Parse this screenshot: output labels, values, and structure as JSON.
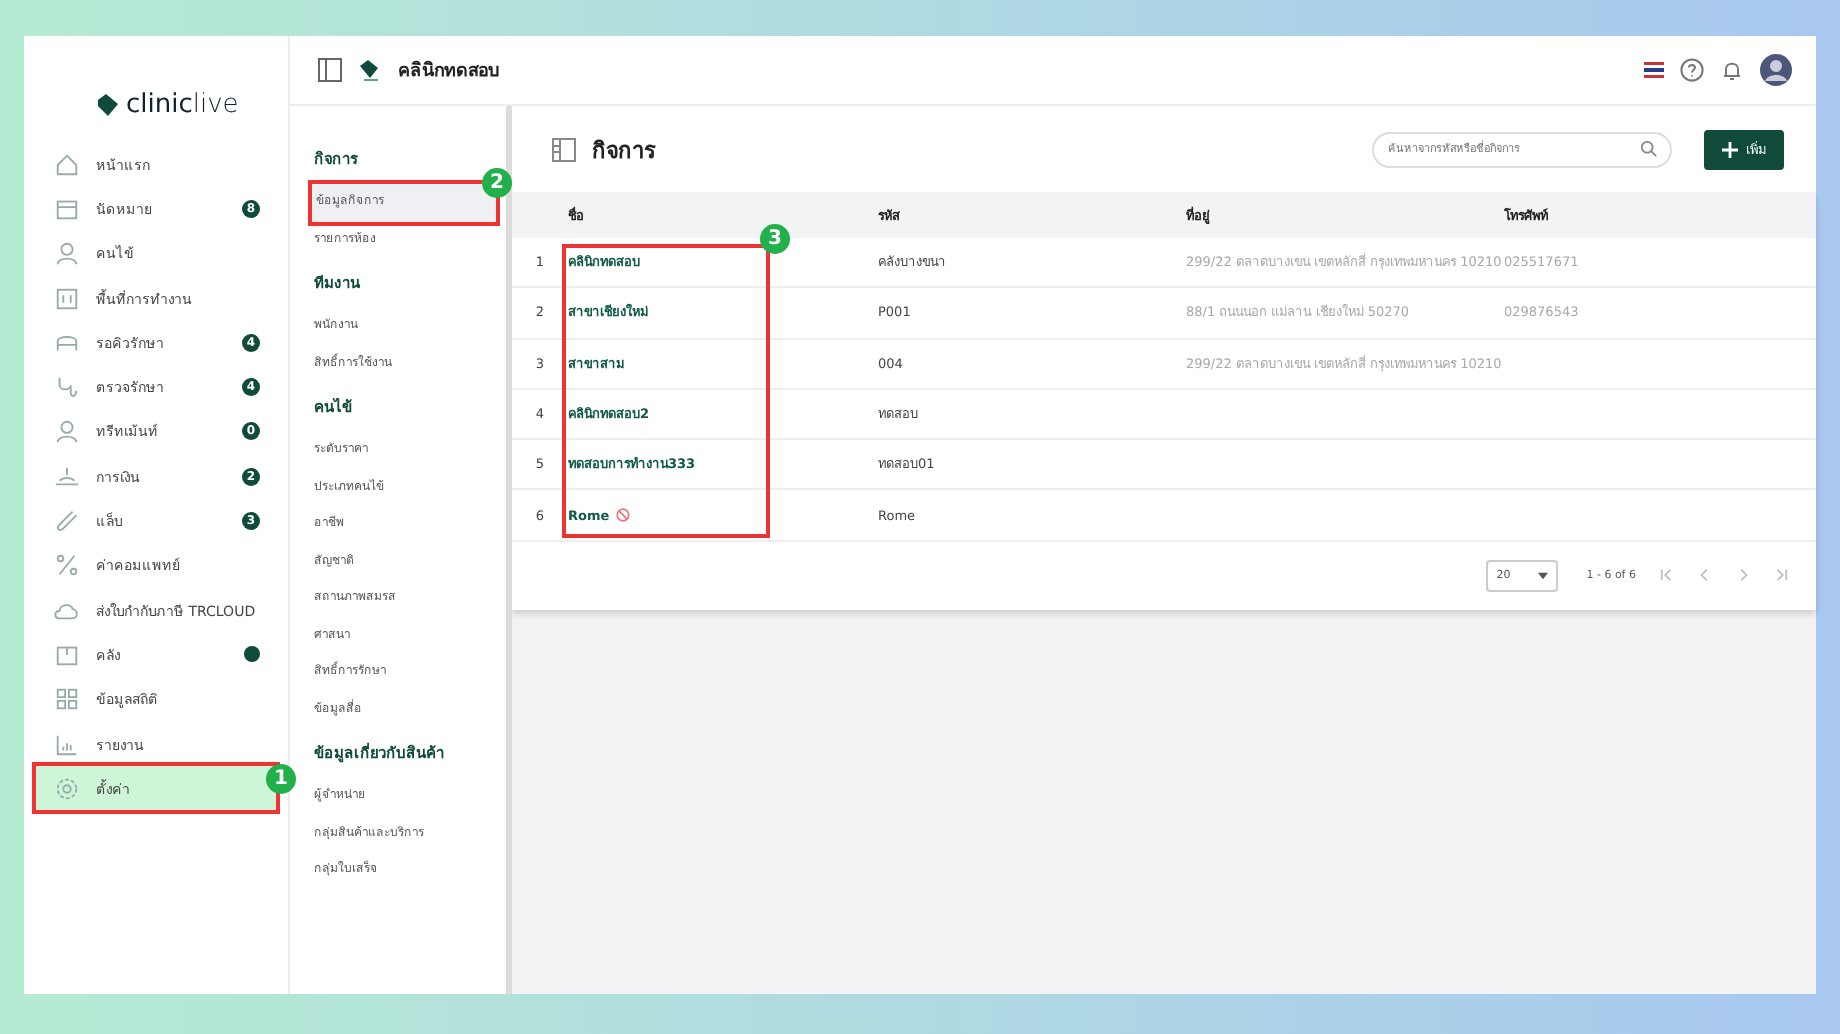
{
  "brand": {
    "name_a": "clinic",
    "name_b": "live"
  },
  "sidebar": {
    "items": [
      {
        "label": "หน้าแรก",
        "selected": false
      },
      {
        "label": "นัดหมาย",
        "badge": "8",
        "selected": false
      },
      {
        "label": "คนไข้",
        "selected": false
      },
      {
        "label": "พื้นที่การทำงาน",
        "selected": false
      },
      {
        "label": "รอคิวรักษา",
        "badge": "4",
        "selected": false
      },
      {
        "label": "ตรวจรักษา",
        "badge": "4",
        "selected": false
      },
      {
        "label": "ทรีทเม้นท์",
        "badge": "0",
        "selected": false
      },
      {
        "label": "การเงิน",
        "badge": "2",
        "selected": false
      },
      {
        "label": "แล็บ",
        "badge": "3",
        "selected": false
      },
      {
        "label": "ค่าคอมแพทย์",
        "selected": false
      },
      {
        "label": "ส่งใบกำกับภาษี TRCLOUD",
        "selected": false
      },
      {
        "label": "คลัง",
        "dot": true,
        "selected": false
      },
      {
        "label": "ข้อมูลสถิติ",
        "selected": false
      },
      {
        "label": "รายงาน",
        "selected": false
      },
      {
        "label": "ตั้งค่า",
        "selected": true,
        "marker": "1"
      }
    ]
  },
  "topbar": {
    "clinic_name": "คลินิกทดสอบ"
  },
  "submenu": {
    "groups": [
      {
        "title": "กิจการ",
        "items": [
          {
            "label": "ข้อมูลกิจการ",
            "selected": true,
            "marker": "2"
          },
          {
            "label": "รายการห้อง",
            "selected": false
          }
        ]
      },
      {
        "title": "ทีมงาน",
        "items": [
          {
            "label": "พนักงาน",
            "selected": false
          },
          {
            "label": "สิทธิ์การใช้งาน",
            "selected": false
          }
        ]
      },
      {
        "title": "คนไข้",
        "items": [
          {
            "label": "ระดับราคา",
            "selected": false
          },
          {
            "label": "ประเภทคนไข้",
            "selected": false
          },
          {
            "label": "อาชีพ",
            "selected": false
          },
          {
            "label": "สัญชาติ",
            "selected": false
          },
          {
            "label": "สถานภาพสมรส",
            "selected": false
          },
          {
            "label": "ศาสนา",
            "selected": false
          },
          {
            "label": "สิทธิ์การรักษา",
            "selected": false
          },
          {
            "label": "ข้อมูลสื่อ",
            "selected": false
          }
        ]
      },
      {
        "title": "ข้อมูลเกี่ยวกับสินค้า",
        "items": [
          {
            "label": "ผู้จำหน่าย",
            "selected": false
          },
          {
            "label": "กลุ่มสินค้าและบริการ",
            "selected": false
          },
          {
            "label": "กลุ่มใบเสร็จ",
            "selected": false
          }
        ]
      }
    ]
  },
  "page": {
    "title": "กิจการ",
    "search": {
      "placeholder": "ค้นหาจากรหัสหรือชื่อกิจการ"
    },
    "add_button": "เพิ่ม"
  },
  "table": {
    "columns": [
      "ชื่อ",
      "รหัส",
      "ที่อยู่",
      "โทรศัพท์"
    ],
    "name_column_marker": "3",
    "rows": [
      {
        "no": "1",
        "name": "คลินิกทดสอบ",
        "code": "คลังบางขนา",
        "address": "299/22 ตลาดบางเขน เขตหลักสี่ กรุงเทพมหานคร 10210",
        "phone": "025517671",
        "disabled": false
      },
      {
        "no": "2",
        "name": "สาขาเชียงใหม่",
        "code": "P001",
        "address": "88/1 ถนนนอก แม่ลาน เชียงใหม่ 50270",
        "phone": "029876543",
        "disabled": false
      },
      {
        "no": "3",
        "name": "สาขาสาม",
        "code": "004",
        "address": "299/22 ตลาดบางเขน เขตหลักสี่ กรุงเทพมหานคร 10210",
        "disabled": false
      },
      {
        "no": "4",
        "name": "คลินิกทดสอบ2",
        "code": "ทดสอบ",
        "disabled": false
      },
      {
        "no": "5",
        "name": "ทดสอบการทำงาน333",
        "code": "ทดสอบ01",
        "disabled": false
      },
      {
        "no": "6",
        "name": "Rome",
        "code": "Rome",
        "disabled": true
      }
    ]
  },
  "pagination": {
    "page_size": "20",
    "range": "1 - 6 of 6"
  }
}
